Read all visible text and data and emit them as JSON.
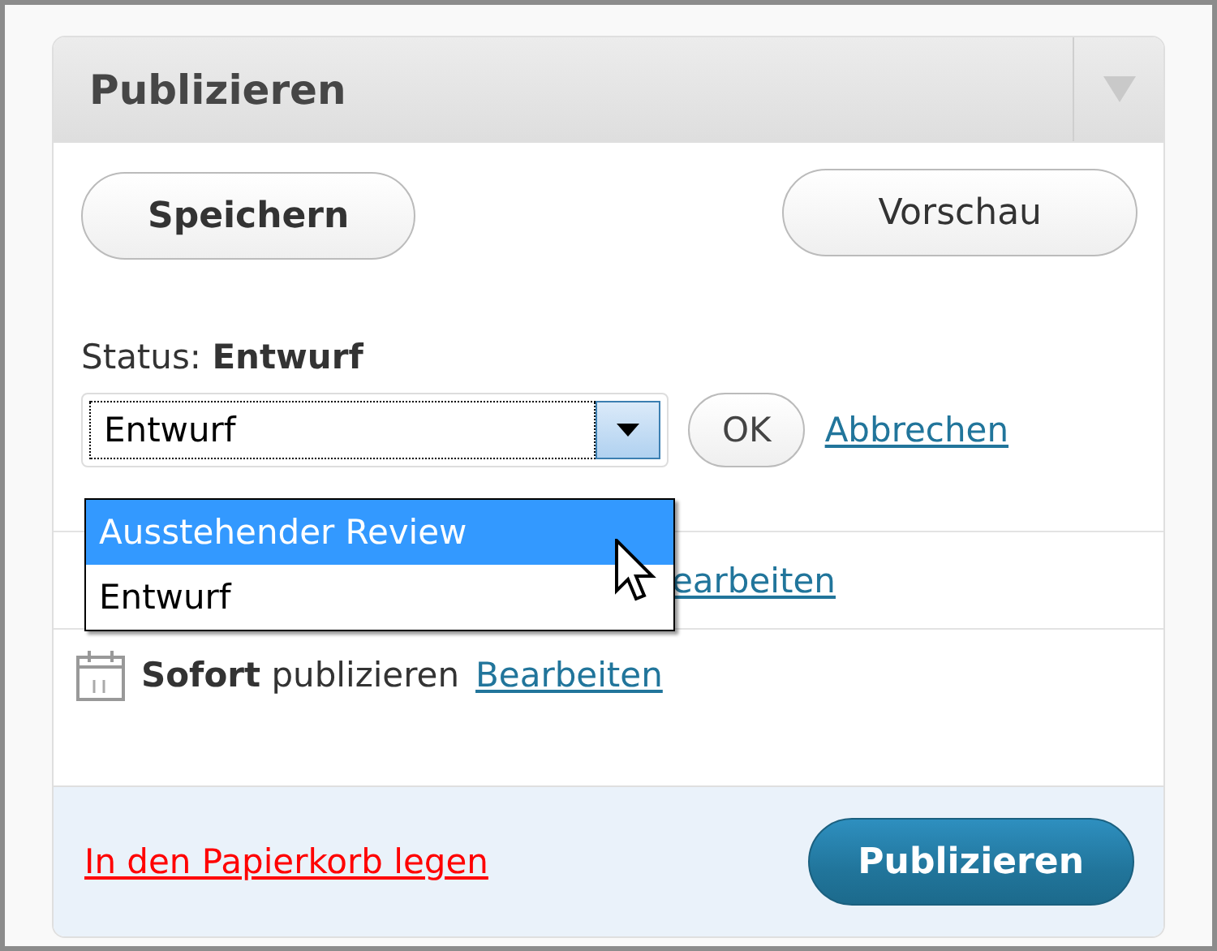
{
  "panel": {
    "title": "Publizieren"
  },
  "save_button": "Speichern",
  "preview_button": "Vorschau",
  "status": {
    "label": "Status:",
    "value": "Entwurf"
  },
  "status_select": {
    "value": "Entwurf",
    "expanded": true,
    "options": [
      {
        "label": "Ausstehender Review",
        "highlighted": true
      },
      {
        "label": "Entwurf",
        "highlighted": false
      }
    ]
  },
  "ok_button": "OK",
  "cancel_link": "Abbrechen",
  "visibility_row": {
    "link": "earbeiten"
  },
  "schedule_row": {
    "text": "**Sofort** publizieren",
    "link": "Bearbeiten"
  },
  "footer": {
    "trash_link": "In den Papierkorb legen",
    "publish_button": "Publizieren"
  }
}
